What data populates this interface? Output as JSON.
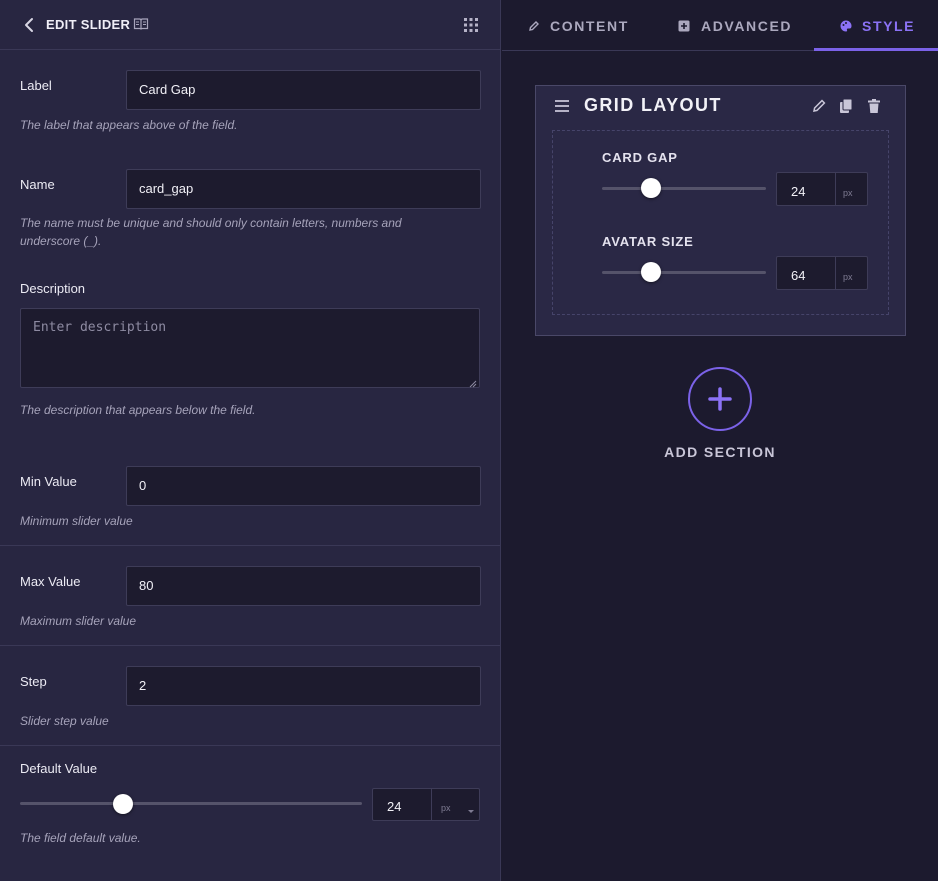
{
  "editor": {
    "title": "EDIT SLIDER",
    "icons": {
      "back": "chevron-left-icon",
      "docs": "book-icon",
      "apps": "grid-icon"
    },
    "fields": {
      "label": {
        "label": "Label",
        "value": "Card Gap",
        "help": "The label that appears above of the field."
      },
      "name": {
        "label": "Name",
        "value": "card_gap",
        "help": "The name must be unique and should only contain letters, numbers and underscore (_)."
      },
      "description": {
        "label": "Description",
        "placeholder": "Enter description",
        "value": "",
        "help": "The description that appears below the field."
      },
      "min": {
        "label": "Min Value",
        "value": "0",
        "help": "Minimum slider value"
      },
      "max": {
        "label": "Max Value",
        "value": "80",
        "help": "Maximum slider value"
      },
      "step": {
        "label": "Step",
        "value": "2",
        "help": "Slider step value"
      },
      "default": {
        "label": "Default Value",
        "value": "24",
        "unit": "px",
        "fraction": 0.3,
        "help": "The field default value."
      }
    }
  },
  "tabs": [
    {
      "label": "CONTENT",
      "icon": "pencil-icon",
      "active": false
    },
    {
      "label": "ADVANCED",
      "icon": "plus-square-icon",
      "active": false
    },
    {
      "label": "STYLE",
      "icon": "palette-icon",
      "active": true
    }
  ],
  "preview": {
    "section_title": "GRID LAYOUT",
    "icons": {
      "menu": "hamburger-icon",
      "edit": "pencil-icon",
      "duplicate": "copy-icon",
      "delete": "trash-icon"
    },
    "controls": [
      {
        "label": "CARD GAP",
        "value": "24",
        "unit": "px",
        "fraction": 0.3
      },
      {
        "label": "AVATAR SIZE",
        "value": "64",
        "unit": "px",
        "fraction": 0.3
      }
    ],
    "add_section_label": "ADD SECTION"
  },
  "colors": {
    "accent": "#7b62e8",
    "panel": "#282641",
    "canvas": "#1c1a2e"
  }
}
